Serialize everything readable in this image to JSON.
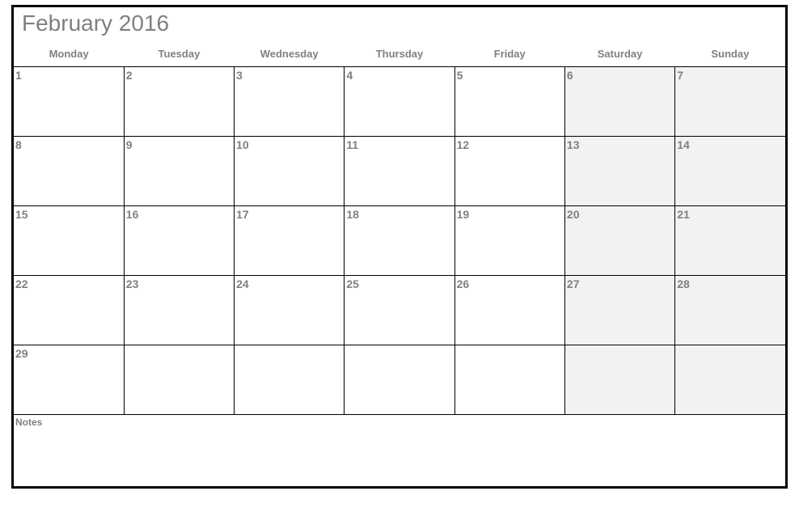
{
  "title": "February 2016",
  "headers": [
    "Monday",
    "Tuesday",
    "Wednesday",
    "Thursday",
    "Friday",
    "Saturday",
    "Sunday"
  ],
  "weeks": [
    [
      {
        "n": "1"
      },
      {
        "n": "2"
      },
      {
        "n": "3"
      },
      {
        "n": "4"
      },
      {
        "n": "5"
      },
      {
        "n": "6",
        "w": true
      },
      {
        "n": "7",
        "w": true
      }
    ],
    [
      {
        "n": "8"
      },
      {
        "n": "9"
      },
      {
        "n": "10"
      },
      {
        "n": "11"
      },
      {
        "n": "12"
      },
      {
        "n": "13",
        "w": true
      },
      {
        "n": "14",
        "w": true
      }
    ],
    [
      {
        "n": "15"
      },
      {
        "n": "16"
      },
      {
        "n": "17"
      },
      {
        "n": "18"
      },
      {
        "n": "19"
      },
      {
        "n": "20",
        "w": true
      },
      {
        "n": "21",
        "w": true
      }
    ],
    [
      {
        "n": "22"
      },
      {
        "n": "23"
      },
      {
        "n": "24"
      },
      {
        "n": "25"
      },
      {
        "n": "26"
      },
      {
        "n": "27",
        "w": true
      },
      {
        "n": "28",
        "w": true
      }
    ],
    [
      {
        "n": "29"
      },
      {
        "n": ""
      },
      {
        "n": ""
      },
      {
        "n": ""
      },
      {
        "n": ""
      },
      {
        "n": "",
        "w": true
      },
      {
        "n": "",
        "w": true
      }
    ]
  ],
  "notes_label": "Notes"
}
